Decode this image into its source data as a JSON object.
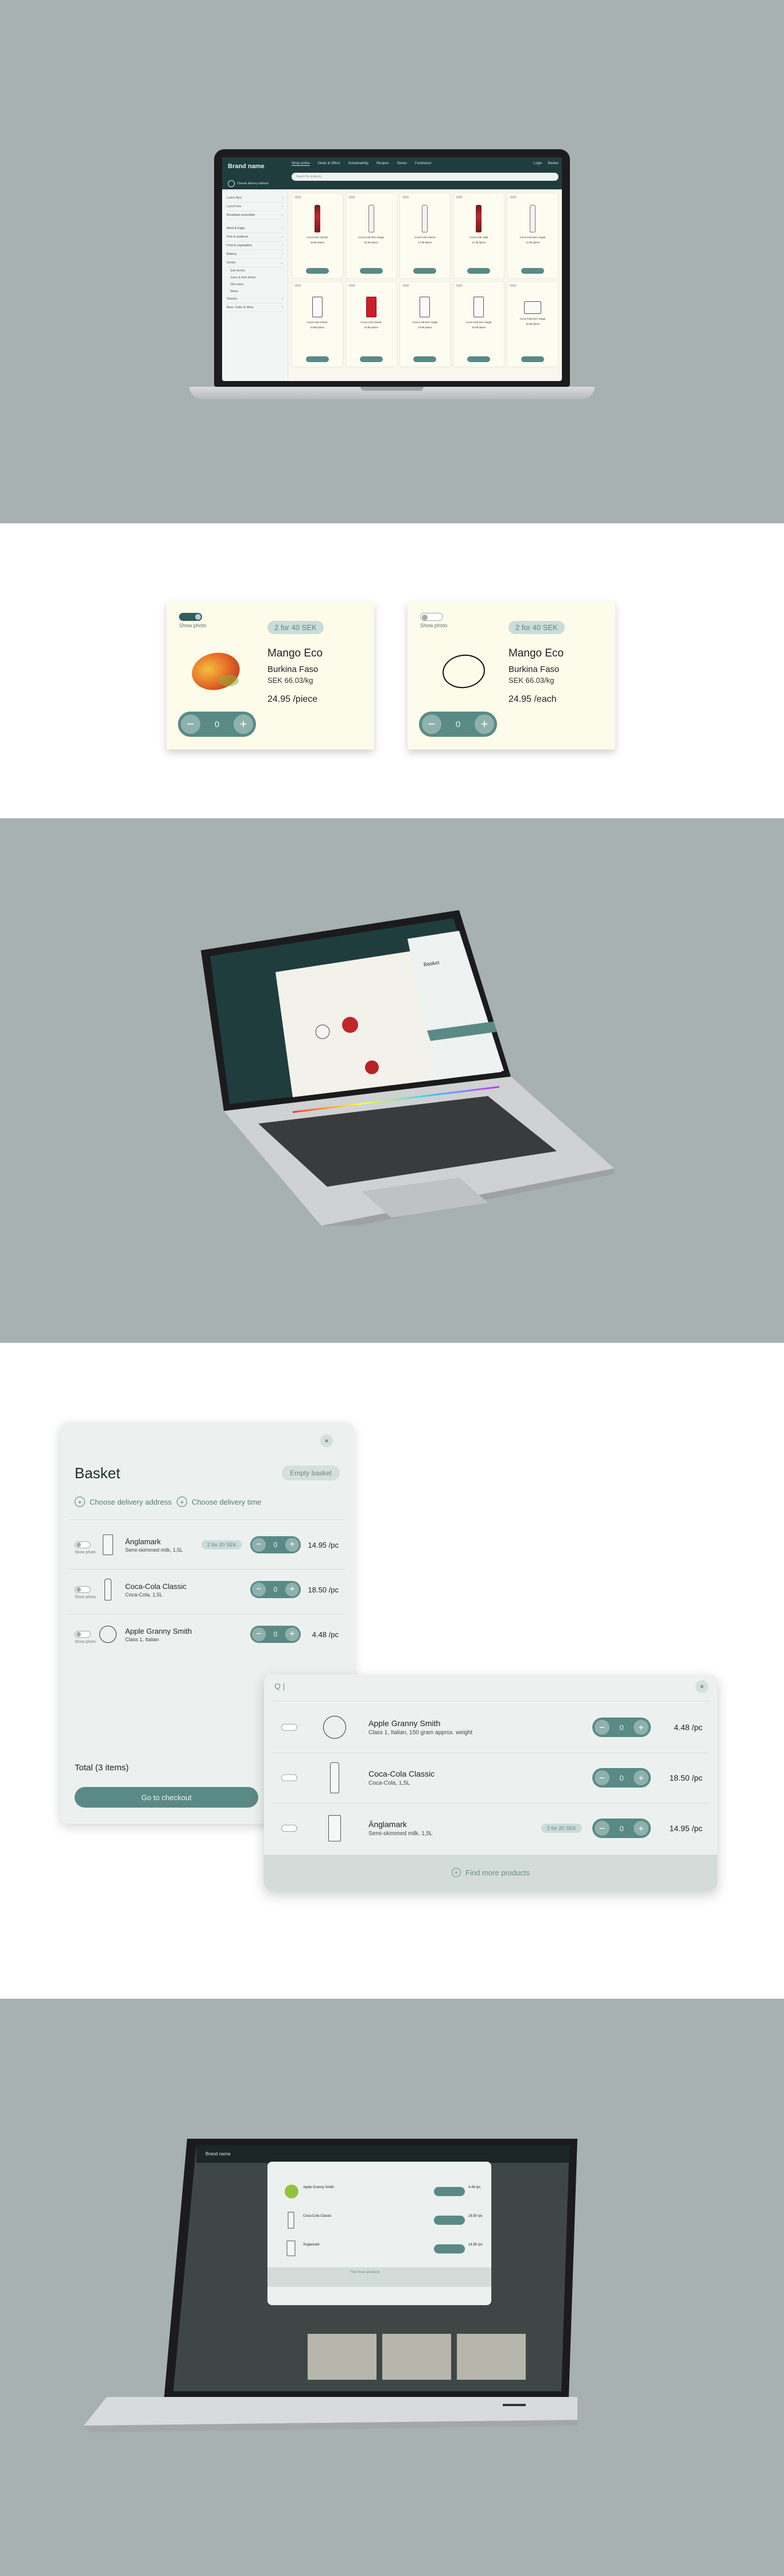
{
  "laptop_app": {
    "brand": "Brand name",
    "nav": [
      "Shop online",
      "Deals & Offers",
      "Sustainability",
      "Recipes",
      "Stores",
      "Fundraiser"
    ],
    "nav_right": [
      "Login",
      "Basket"
    ],
    "search_placeholder": "Search for products",
    "delivery_text": "Choose delivery address",
    "sidebar": {
      "categories": [
        "Lunch Box",
        "Lunch box",
        "Breakfast essentials",
        "Meat & Eggs",
        "Fish & seafood",
        "Fruit & vegetables",
        "Bakery",
        "Drinks",
        "Snacks"
      ],
      "drinks_sub": [
        "Soft drinks",
        "Juice & fruit drinks",
        "Still water",
        "Water"
      ],
      "extra": [
        "Beer, Cider & Wine"
      ]
    },
    "products": [
      {
        "name": "Coca-Cola Classic",
        "price": "16.50 /piece",
        "kind": "red-bottle"
      },
      {
        "name": "Coca-Cola Zero Sugar",
        "price": "18.50 /piece",
        "kind": "clear-bottle"
      },
      {
        "name": "Coca-Cola Classic",
        "price": "17.95 /piece",
        "kind": "clear-bottle"
      },
      {
        "name": "Coca-Cola Light",
        "price": "17.95 /piece",
        "kind": "red-bottle"
      },
      {
        "name": "Coca-Cola Zero Sugar",
        "price": "17.95 /piece",
        "kind": "clear-bottle"
      },
      {
        "name": "Coca-Cola Classic",
        "price": "10.95 /piece",
        "kind": "can"
      },
      {
        "name": "Coca-Cola Classic",
        "price": "10.95 /piece",
        "kind": "red-can"
      },
      {
        "name": "Coca-Cola Zero Sugar",
        "price": "10.95 /piece",
        "kind": "can"
      },
      {
        "name": "Coca-Cola Zero Sugar",
        "price": "10.95 /piece",
        "kind": "can"
      },
      {
        "name": "Coca-Cola Zero Sugar",
        "price": "10.95 /piece",
        "kind": "wide-can"
      }
    ]
  },
  "cards": [
    {
      "switch_label": "Show photo",
      "badge": "2 for 40 SEK",
      "title": "Mango Eco",
      "origin": "Burkina Faso",
      "unit": "SEK 66.03/kg",
      "price": "24.95 /piece",
      "qty": "0"
    },
    {
      "switch_label": "Show photo",
      "badge": "2 for 40 SEK",
      "title": "Mango Eco",
      "origin": "Burkina Faso",
      "unit": "SEK 66.03/kg",
      "price": "24.95 /each",
      "qty": "0"
    }
  ],
  "angled_laptop": {
    "panel_title": "Basket",
    "checkout_label": "Go to checkout"
  },
  "basket": {
    "title": "Basket",
    "empty_label": "Empty basket",
    "address_label": "Choose delivery address",
    "time_label": "Choose delivery time",
    "switch_label": "Show photo",
    "items": [
      {
        "name": "Änglamark",
        "sub": "Semi-skimmed milk, 1,5L",
        "offer": "2 for 20 SEK",
        "qty": "0",
        "price": "14.95 /pc",
        "kind": "carton"
      },
      {
        "name": "Coca-Cola Classic",
        "sub": "Coca-Cola, 1,5L",
        "offer": "",
        "qty": "0",
        "price": "18.50 /pc",
        "kind": "bottle"
      },
      {
        "name": "Apple Granny Smith",
        "sub": "Class 1, Italian",
        "offer": "",
        "qty": "0",
        "price": "4.48 /pc",
        "kind": "apple"
      }
    ],
    "total_label": "Total (3 items)",
    "checkout_label": "Go to checkout",
    "close": "×"
  },
  "search_panel": {
    "query": "Q  |",
    "close": "×",
    "items": [
      {
        "name": "Apple Granny Smith",
        "sub": "Class 1, Italian, 150 gram approx. weight",
        "offer": "",
        "qty": "0",
        "price": "4.48 /pc",
        "kind": "apple"
      },
      {
        "name": "Coca-Cola Classic",
        "sub": "Coca-Cola, 1,5L",
        "offer": "",
        "qty": "0",
        "price": "18.50 /pc",
        "kind": "bottle"
      },
      {
        "name": "Änglamark",
        "sub": "Semi-skimmed milk, 1,5L",
        "offer": "2 for 20 SEK",
        "qty": "0",
        "price": "14.95 /pc",
        "kind": "carton"
      }
    ],
    "footer_label": "Find more products"
  },
  "laptop5": {
    "brand": "Brand name",
    "overlay_items": [
      {
        "name": "Apple Granny Smith",
        "price": "4.48 /pc"
      },
      {
        "name": "Coca-Cola Classic",
        "price": "18.50 /pc"
      },
      {
        "name": "Änglamark",
        "price": "14.95 /pc"
      }
    ],
    "overlay_footer": "Find more products"
  },
  "colors": {
    "background_grey": "#a7b1b0",
    "header_dark": "#1f3d3c",
    "accent_teal": "#5a8a86",
    "card_cream": "#fdfbea",
    "panel_light": "#ecf1ef"
  }
}
